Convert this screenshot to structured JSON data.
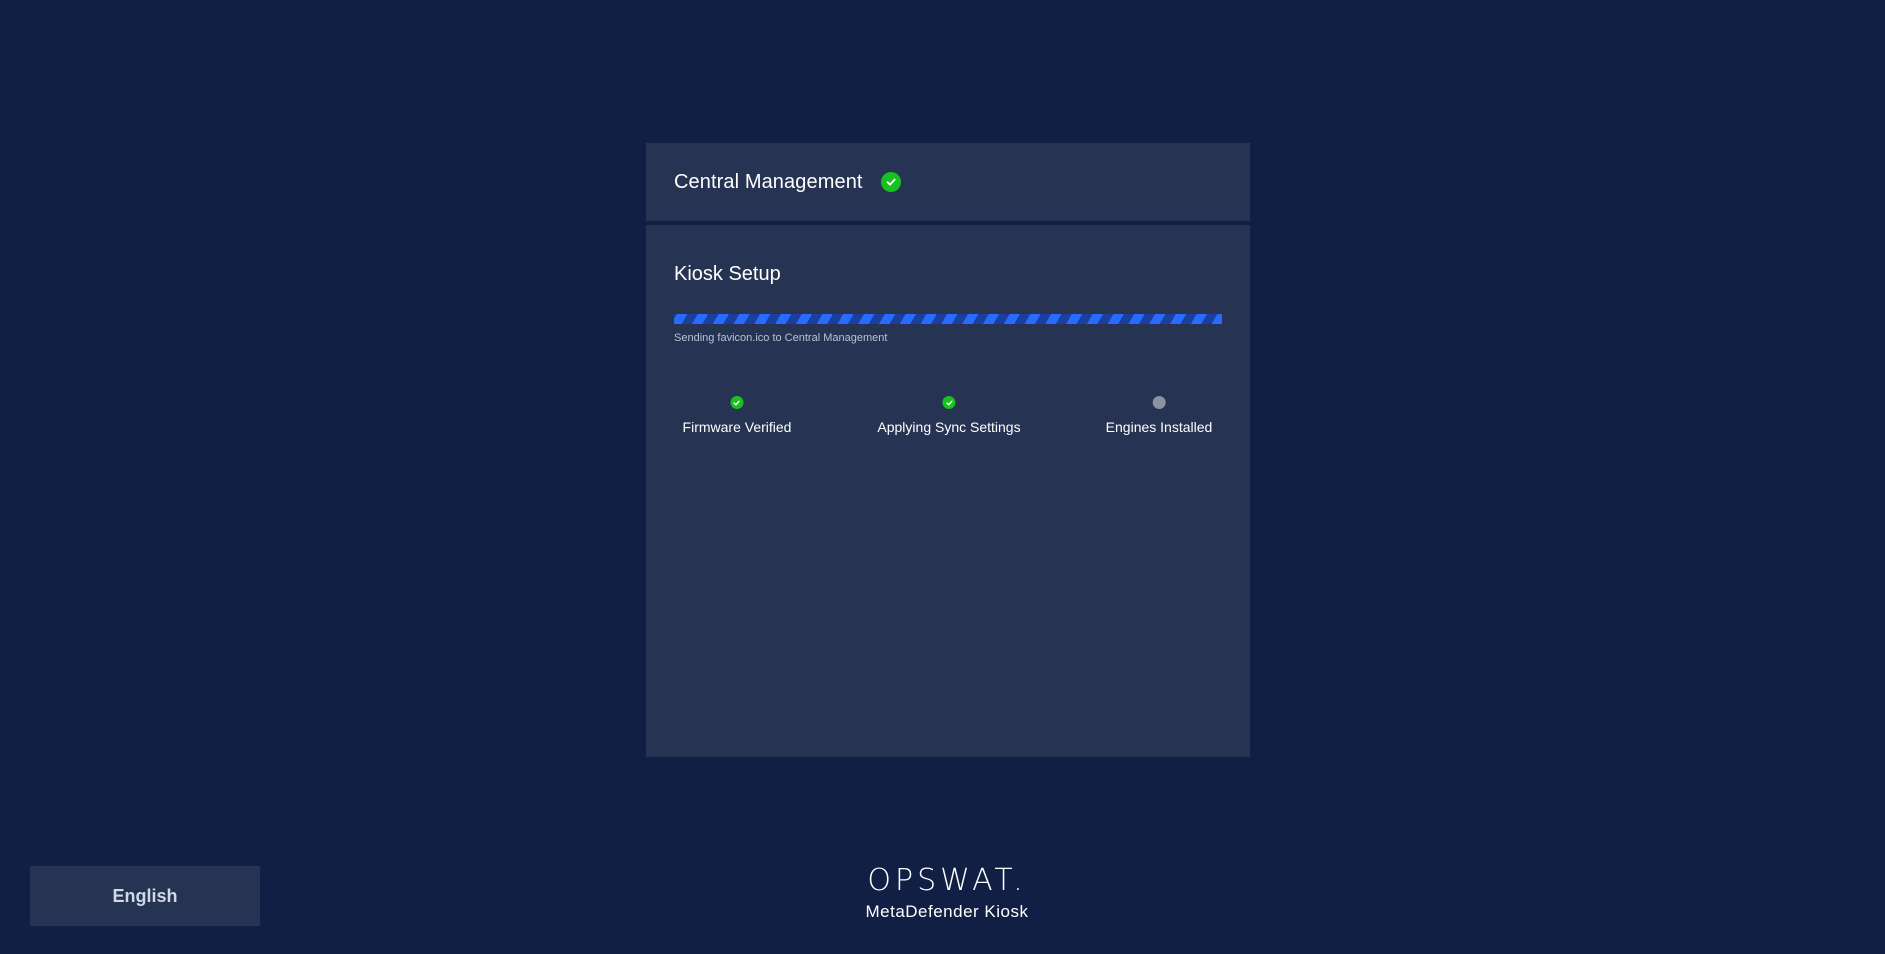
{
  "central_management": {
    "title": "Central Management",
    "status_icon": "check-circle-icon",
    "status_color": "#17c21f"
  },
  "kiosk_setup": {
    "title": "Kiosk Setup",
    "progress": {
      "percent": 100,
      "status_text": "Sending favicon.ico to Central Management",
      "color": "#2a6bff"
    },
    "steps": [
      {
        "label": "Firmware Verified",
        "state": "complete",
        "icon": "check-circle-icon"
      },
      {
        "label": "Applying Sync Settings",
        "state": "complete",
        "icon": "check-circle-icon"
      },
      {
        "label": "Engines Installed",
        "state": "pending",
        "icon": "pending-dot-icon"
      }
    ]
  },
  "language_button": {
    "label": "English"
  },
  "brand": {
    "logo_text": "OPSWAT.",
    "product_name": "MetaDefender Kiosk"
  },
  "colors": {
    "background": "#111f44",
    "panel": "#263352",
    "success": "#17c21f",
    "pending": "#8b93a3"
  }
}
